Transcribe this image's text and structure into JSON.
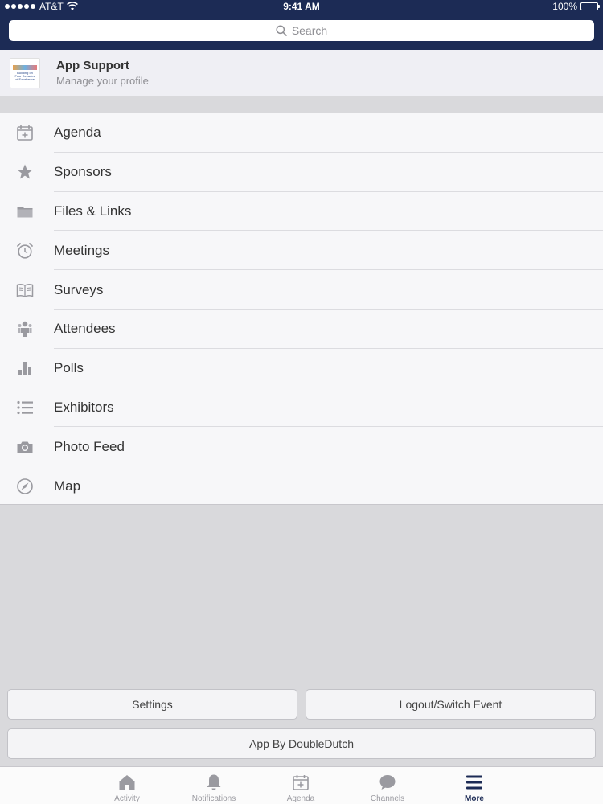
{
  "status_bar": {
    "carrier": "AT&T",
    "time": "9:41 AM",
    "battery": "100%",
    "battery_level": 1.0
  },
  "search": {
    "placeholder": "Search",
    "icon": "search-icon"
  },
  "profile": {
    "title": "App Support",
    "subtitle": "Manage your profile",
    "avatar_text": [
      "Building on",
      "Four Decades",
      "of Excellence"
    ]
  },
  "menu": {
    "items": [
      {
        "label": "Agenda",
        "icon": "calendar-icon"
      },
      {
        "label": "Sponsors",
        "icon": "star-icon"
      },
      {
        "label": "Files & Links",
        "icon": "folder-icon"
      },
      {
        "label": "Meetings",
        "icon": "alarm-clock-icon"
      },
      {
        "label": "Surveys",
        "icon": "open-book-icon"
      },
      {
        "label": "Attendees",
        "icon": "people-icon"
      },
      {
        "label": "Polls",
        "icon": "bar-chart-icon"
      },
      {
        "label": "Exhibitors",
        "icon": "list-icon"
      },
      {
        "label": "Photo Feed",
        "icon": "camera-icon"
      },
      {
        "label": "Map",
        "icon": "compass-icon"
      }
    ]
  },
  "buttons": {
    "settings": "Settings",
    "logout": "Logout/Switch Event",
    "app_by": "App By DoubleDutch"
  },
  "tabbar": {
    "tabs": [
      {
        "label": "Activity",
        "icon": "home-icon"
      },
      {
        "label": "Notifications",
        "icon": "bell-icon"
      },
      {
        "label": "Agenda",
        "icon": "calendar-icon"
      },
      {
        "label": "Channels",
        "icon": "chat-bubble-icon"
      },
      {
        "label": "More",
        "icon": "menu-icon"
      }
    ],
    "active": "More"
  },
  "colors": {
    "header": "#1c2b55",
    "background": "#d9d9dc",
    "list_background": "#f7f7f9",
    "icon_gray": "#9a9aa0",
    "text": "#333333",
    "active_tab": "#1c2b55"
  }
}
